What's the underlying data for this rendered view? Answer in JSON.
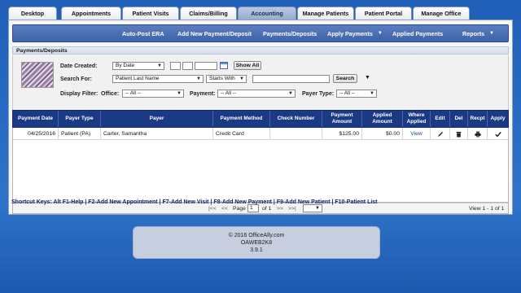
{
  "tabs": [
    {
      "label": "Desktop",
      "active": false
    },
    {
      "label": "Appointments",
      "active": false
    },
    {
      "label": "Patient Visits",
      "active": false
    },
    {
      "label": "Claims/Billing",
      "active": false
    },
    {
      "label": "Accounting",
      "active": true
    },
    {
      "label": "Manage Patients",
      "active": false
    },
    {
      "label": "Patient Portal",
      "active": false
    },
    {
      "label": "Manage Office",
      "active": false
    }
  ],
  "subnav": {
    "auto_post": "Auto-Post ERA",
    "add_payment": "Add New Payment/Deposit",
    "payments": "Payments/Deposits",
    "apply_payments": "Apply Payments",
    "applied_payments": "Applied Payments",
    "reports": "Reports"
  },
  "section": {
    "title": "Payments/Deposits"
  },
  "filters": {
    "date_created_label": "Date Created:",
    "date_mode": "By Date",
    "show_all": "Show All",
    "search_for_label": "Search For:",
    "search_field": "Patient Last Name",
    "search_op": "Starts With",
    "search_value": "",
    "search_button": "Search",
    "display_filter_label": "Display Filter:",
    "office_label": "Office:",
    "office_value": "-- All --",
    "payment_label": "Payment:",
    "payment_value": "-- All --",
    "payer_type_label": "Payer Type:",
    "payer_type_value": "-- All --"
  },
  "table": {
    "headers": [
      "Payment Date",
      "Payer Type",
      "Payer",
      "Payment Method",
      "Check Number",
      "Payment Amount",
      "Applied Amount",
      "Where Applied",
      "Edit",
      "Del",
      "Recpt",
      "Apply"
    ],
    "rows": [
      {
        "payment_date": "04/25/2016",
        "payer_type": "Patient (PA)",
        "payer": "Carter, Samantha",
        "payment_method": "Credit Card",
        "check_number": "",
        "payment_amount": "$125.00",
        "applied_amount": "$0.00",
        "where_applied": "View"
      }
    ]
  },
  "pager": {
    "first": "|<<",
    "prev": "<<",
    "page_label": "Page",
    "page_value": "1",
    "of_label": "of 1",
    "next": ">>",
    "last": ">>|",
    "summary": "View 1 - 1 of 1"
  },
  "shortcuts": {
    "prefix": "Shortcut Keys:",
    "items": [
      "Alt F1-Help",
      "F2-Add New Appointment",
      "F7-Add New Visit",
      "F8-Add New Payment",
      "F9-Add New Patient",
      "F10-Patient List"
    ]
  },
  "footer": {
    "copyright": "© 2016 OfficeAlly.com",
    "server": "OAWEB2K8",
    "version": "3.9.1"
  }
}
